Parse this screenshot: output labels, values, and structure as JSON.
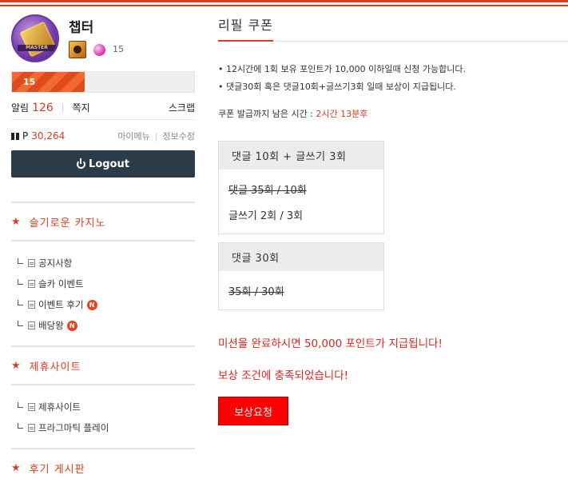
{
  "profile": {
    "nickname": "챕터",
    "level": "15",
    "exp_label": "15",
    "exp_progress_percent": 40,
    "avatar_text": "MASTER"
  },
  "account": {
    "alarm_label": "알림",
    "alarm_count": "126",
    "memo_label": "쪽지",
    "scrap_label": "스크랩",
    "point_label": "P",
    "point_value": "30,264",
    "mymenu_label": "마이메뉴",
    "editinfo_label": "정보수정",
    "logout_label": "Logout"
  },
  "sidebar": {
    "sections": [
      {
        "title": "슬기로운 카지노",
        "items": [
          {
            "label": "공지사항",
            "new": false
          },
          {
            "label": "슬카 이벤트",
            "new": false
          },
          {
            "label": "이벤트 후기",
            "new": true
          },
          {
            "label": "배당왕",
            "new": true
          }
        ]
      },
      {
        "title": "제휴사이트",
        "items": [
          {
            "label": "제휴사이트",
            "new": false
          },
          {
            "label": "프라그마틱 플레이",
            "new": false
          }
        ]
      },
      {
        "title": "후기 게시판",
        "items": []
      }
    ],
    "new_badge": "N"
  },
  "main": {
    "title": "리필 쿠폰",
    "notices": [
      "• 12시간에 1회 보유 포인트가 10,000 이하일때 신청 가능합니다.",
      "• 댓글30회 혹은 댓글10회+글쓰기3회 일때 보상이 지급됩니다."
    ],
    "remain_label": "쿠폰 발급까지 남은 시간 : ",
    "remain_time": "2시간 13분후",
    "missions": [
      {
        "title": "댓글 10회 + 글쓰기 3회",
        "lines": [
          {
            "text": "댓글 35회 / 10회",
            "done": true
          },
          {
            "text": "글쓰기 2회 / 3회",
            "done": false
          }
        ]
      },
      {
        "title": "댓글 30회",
        "lines": [
          {
            "text": "35회 / 30회",
            "done": true
          }
        ]
      }
    ],
    "complete_message": "미션을 완료하시면 50,000 포인트가 지급됩니다!",
    "satisfied_message": "보상 조건에 충족되었습니다!",
    "reward_button": "보상요청"
  },
  "colors": {
    "accent": "#e03c1f",
    "logout_bg": "#2c3b48",
    "reward_bg": "#ff0000"
  }
}
